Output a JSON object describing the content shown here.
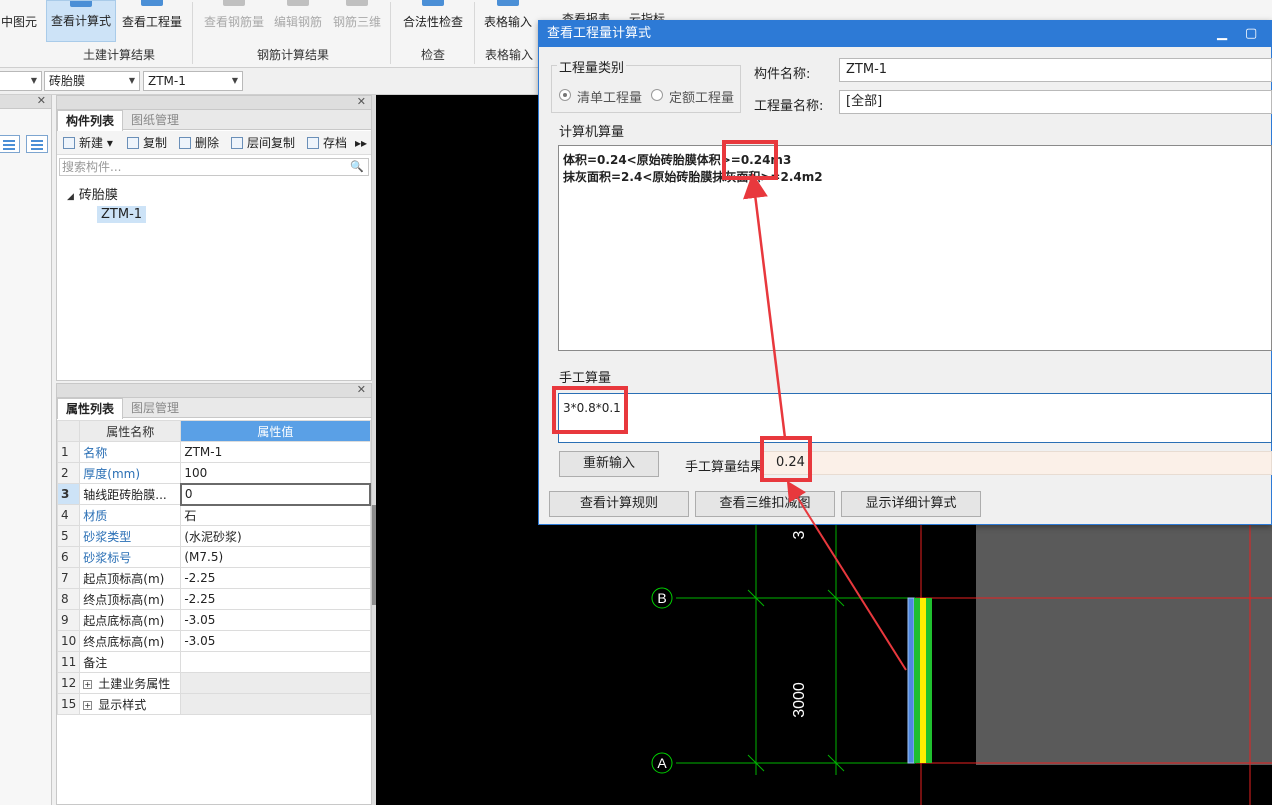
{
  "ribbon": {
    "buttons": [
      {
        "label": "中图元"
      },
      {
        "label": "查看计算式"
      },
      {
        "label": "查看工程量"
      },
      {
        "label": "查看钢筋量"
      },
      {
        "label": "编辑钢筋"
      },
      {
        "label": "钢筋三维"
      },
      {
        "label": "合法性检查"
      },
      {
        "label": "表格输入"
      },
      {
        "label": "查看报表"
      },
      {
        "label": "云指标"
      }
    ],
    "groups": [
      "土建计算结果",
      "钢筋计算结果",
      "检查",
      "表格输入"
    ]
  },
  "combos": [
    "砖胎膜",
    "ZTM-1"
  ],
  "component_panel": {
    "tabs": [
      "构件列表",
      "图纸管理"
    ],
    "toolbar": [
      "新建",
      "复制",
      "删除",
      "层间复制",
      "存档"
    ],
    "search_placeholder": "搜索构件...",
    "tree_root": "砖胎膜",
    "tree_child": "ZTM-1"
  },
  "property_panel": {
    "tabs": [
      "属性列表",
      "图层管理"
    ],
    "header_name": "属性名称",
    "header_value": "属性值",
    "rows": [
      {
        "num": "1",
        "name": "名称",
        "value": "ZTM-1"
      },
      {
        "num": "2",
        "name": "厚度(mm)",
        "value": "100"
      },
      {
        "num": "3",
        "name": "轴线距砖胎膜...",
        "value": "0"
      },
      {
        "num": "4",
        "name": "材质",
        "value": "石"
      },
      {
        "num": "5",
        "name": "砂浆类型",
        "value": "(水泥砂浆)"
      },
      {
        "num": "6",
        "name": "砂浆标号",
        "value": "(M7.5)"
      },
      {
        "num": "7",
        "name": "起点顶标高(m)",
        "value": "-2.25"
      },
      {
        "num": "8",
        "name": "终点顶标高(m)",
        "value": "-2.25"
      },
      {
        "num": "9",
        "name": "起点底标高(m)",
        "value": "-3.05"
      },
      {
        "num": "10",
        "name": "终点底标高(m)",
        "value": "-3.05"
      },
      {
        "num": "11",
        "name": "备注",
        "value": ""
      },
      {
        "num": "12",
        "name": "土建业务属性",
        "value": ""
      },
      {
        "num": "15",
        "name": "显示样式",
        "value": ""
      }
    ]
  },
  "canvas": {
    "axis_labels": [
      "B",
      "A"
    ],
    "dimension_main": "3000",
    "dimension_partial": "3"
  },
  "dialog": {
    "title": "查看工程量计算式",
    "category_legend": "工程量类别",
    "radio_list": "清单工程量",
    "radio_quota": "定额工程量",
    "component_name_label": "构件名称:",
    "component_name_value": "ZTM-1",
    "quantity_name_label": "工程量名称:",
    "quantity_name_value": "[全部]",
    "computer_legend": "计算机算量",
    "formula_line1": "体积=0.24<原始砖胎膜体积>=0.24m3",
    "formula_line2": "抹灰面积=2.4<原始砖胎膜抹灰面积>=2.4m2",
    "manual_legend": "手工算量",
    "manual_input": "3*0.8*0.1",
    "reenter_button": "重新输入",
    "manual_result_label": "手工算量结果=",
    "manual_result_value": "0.24",
    "view_rules_button": "查看计算规则",
    "view_3d_button": "查看三维扣减图",
    "show_detail_button": "显示详细计算式"
  },
  "colors": {
    "accent_blue": "#2d7ad6",
    "highlight_red": "#e8383d",
    "header_blue": "#5aa0e6"
  }
}
